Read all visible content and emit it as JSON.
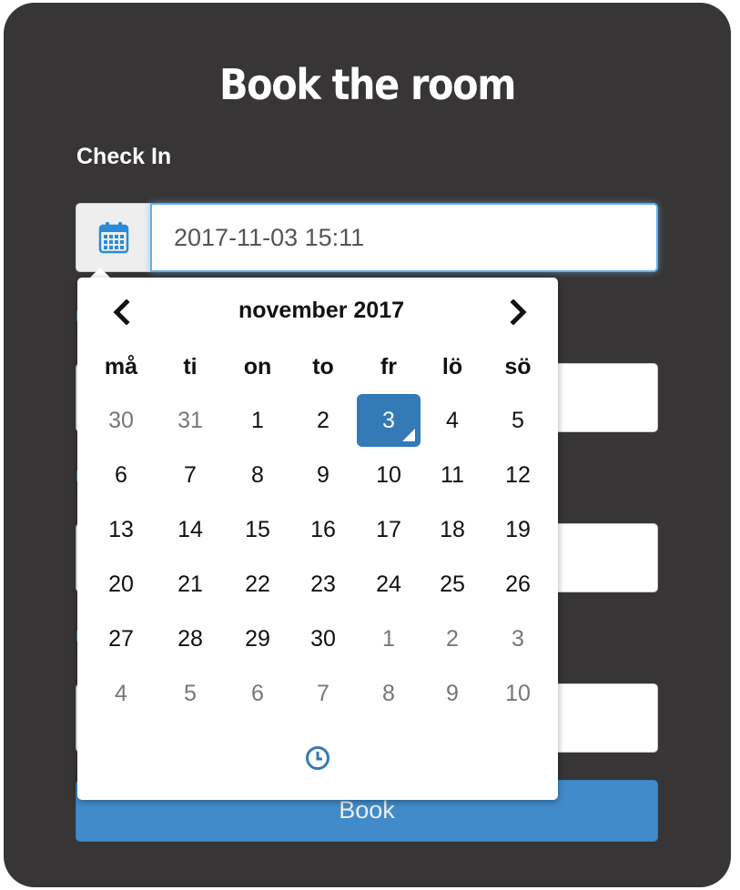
{
  "form": {
    "title": "Book the room",
    "check_in_label": "Check In",
    "check_in_value": "2017-11-03 15:11",
    "book_button": "Book"
  },
  "datepicker": {
    "month_label": "november 2017",
    "weekdays": [
      "må",
      "ti",
      "on",
      "to",
      "fr",
      "lö",
      "sö"
    ],
    "selected_day": "3",
    "weeks": [
      [
        "30",
        "31",
        "1",
        "2",
        "3",
        "4",
        "5"
      ],
      [
        "6",
        "7",
        "8",
        "9",
        "10",
        "11",
        "12"
      ],
      [
        "13",
        "14",
        "15",
        "16",
        "17",
        "18",
        "19"
      ],
      [
        "20",
        "21",
        "22",
        "23",
        "24",
        "25",
        "26"
      ],
      [
        "27",
        "28",
        "29",
        "30",
        "1",
        "2",
        "3"
      ],
      [
        "4",
        "5",
        "6",
        "7",
        "8",
        "9",
        "10"
      ]
    ],
    "prev_icon": "chevron-left-icon",
    "next_icon": "chevron-right-icon",
    "time_icon": "clock-icon"
  },
  "colors": {
    "card_background": "#373536",
    "accent": "#337ab7",
    "button": "#428bca",
    "muted_day": "#777777"
  }
}
